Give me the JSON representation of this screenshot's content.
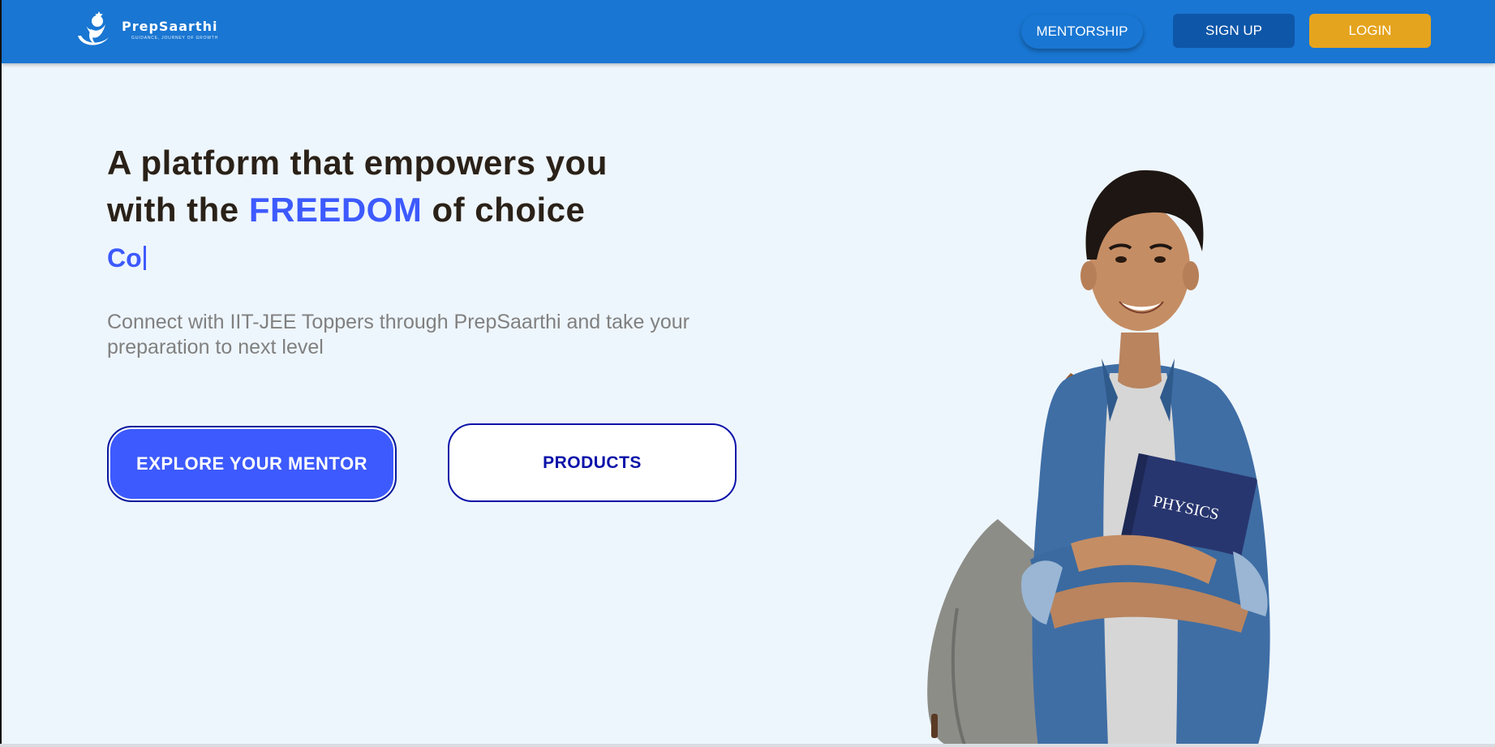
{
  "header": {
    "brand_name": "PrepSaarthi",
    "brand_tagline": "GUIDANCE, JOURNEY OF GROWTH",
    "nav": {
      "mentorship": "MENTORSHIP",
      "signup": "SIGN UP",
      "login": "LOGIN"
    }
  },
  "hero": {
    "headline_line1": "A platform that empowers you",
    "headline_line2_pre": "with the ",
    "headline_accent": "FREEDOM",
    "headline_line2_post": " of choice",
    "typed_text": "Co",
    "subtext": "Connect with IIT-JEE Toppers through PrepSaarthi and take your preparation to next level",
    "cta_primary": "EXPLORE YOUR MENTOR",
    "cta_secondary": "PRODUCTS",
    "book_label": "PHYSICS"
  },
  "colors": {
    "header_bg": "#1976d2",
    "accent": "#3d5afe",
    "login": "#e5a41e",
    "signup": "#0e56a8",
    "page_bg": "#eef6fd"
  }
}
